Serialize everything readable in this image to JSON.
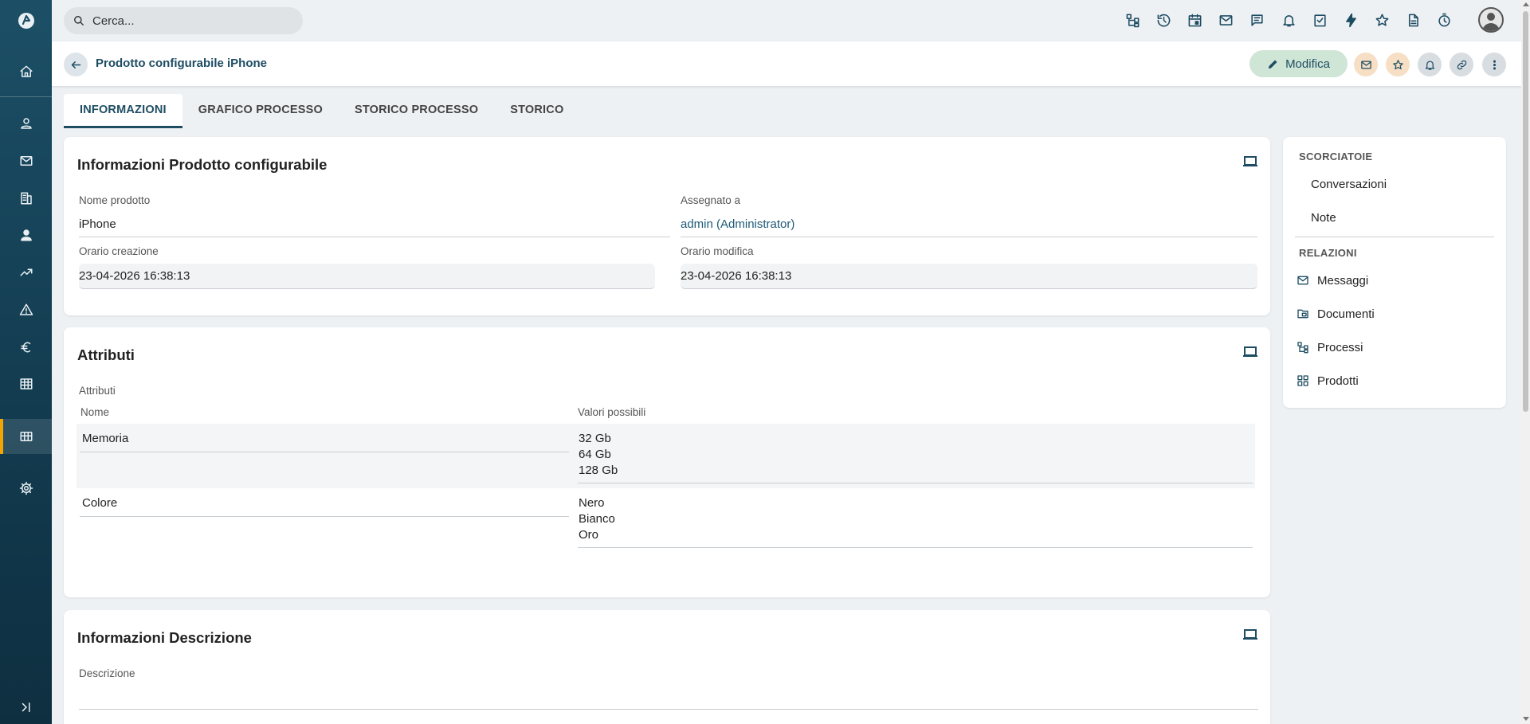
{
  "sidebar": {
    "items": [
      {
        "name": "home-icon"
      },
      {
        "name": "user-icon"
      },
      {
        "name": "mail-icon"
      },
      {
        "name": "building-icon"
      },
      {
        "name": "person-icon"
      },
      {
        "name": "trending-up-icon"
      },
      {
        "name": "warning-icon"
      },
      {
        "name": "euro-icon"
      },
      {
        "name": "table-icon"
      },
      {
        "name": "products-icon"
      },
      {
        "name": "settings-icon"
      },
      {
        "name": "expand-icon"
      }
    ],
    "active_item": "products-icon",
    "accent_color": "#f0a500"
  },
  "topbar": {
    "search_placeholder": "Cerca...",
    "icons": [
      "process-icon",
      "history-icon",
      "calendar-icon",
      "mail-icon",
      "chat-icon",
      "bell-icon",
      "task-icon",
      "flash-icon",
      "star-icon",
      "document-icon",
      "timer-icon",
      "avatar"
    ]
  },
  "header": {
    "title": "Prodotto configurabile iPhone",
    "edit_label": "Modifica",
    "buttons": [
      "mail-icon",
      "star-icon",
      "bell-icon",
      "link-icon",
      "more-icon"
    ]
  },
  "tabs": [
    {
      "label": "INFORMAZIONI",
      "active": true
    },
    {
      "label": "GRAFICO PROCESSO",
      "active": false
    },
    {
      "label": "STORICO PROCESSO",
      "active": false
    },
    {
      "label": "STORICO",
      "active": false
    }
  ],
  "info_panel": {
    "title": "Informazioni Prodotto configurabile",
    "fields": {
      "nome_label": "Nome prodotto",
      "nome_value": "iPhone",
      "assegnato_label": "Assegnato a",
      "assegnato_value": "admin (Administrator)",
      "creazione_label": "Orario creazione",
      "creazione_value": "23-04-2026 16:38:13",
      "modifica_label": "Orario modifica",
      "modifica_value": "23-04-2026 16:38:13"
    }
  },
  "attributes_panel": {
    "title": "Attributi",
    "field_label": "Attributi",
    "col_name": "Nome",
    "col_values": "Valori possibili",
    "rows": [
      {
        "name": "Memoria",
        "values": [
          "32 Gb",
          "64 Gb",
          "128 Gb"
        ]
      },
      {
        "name": "Colore",
        "values": [
          "Nero",
          "Bianco",
          "Oro"
        ]
      }
    ]
  },
  "description_panel": {
    "title": "Informazioni Descrizione",
    "field_label": "Descrizione",
    "value": ""
  },
  "right_panel": {
    "shortcuts_title": "SCORCIATOIE",
    "shortcuts": [
      "Conversazioni",
      "Note"
    ],
    "relations_title": "RELAZIONI",
    "relations": [
      {
        "label": "Messaggi",
        "icon": "mail-icon"
      },
      {
        "label": "Documenti",
        "icon": "folder-icon"
      },
      {
        "label": "Processi",
        "icon": "process-icon"
      },
      {
        "label": "Prodotti",
        "icon": "products-icon"
      }
    ]
  },
  "colors": {
    "primary": "#1e4d63",
    "edit_button_bg": "#cfe5d5",
    "mail_button_bg": "#f6dfc4",
    "star_button_bg": "#f6dfc4",
    "bell_button_bg": "#d7dde1",
    "link_button_bg": "#d7dde1",
    "more_button_bg": "#d7dde1"
  }
}
